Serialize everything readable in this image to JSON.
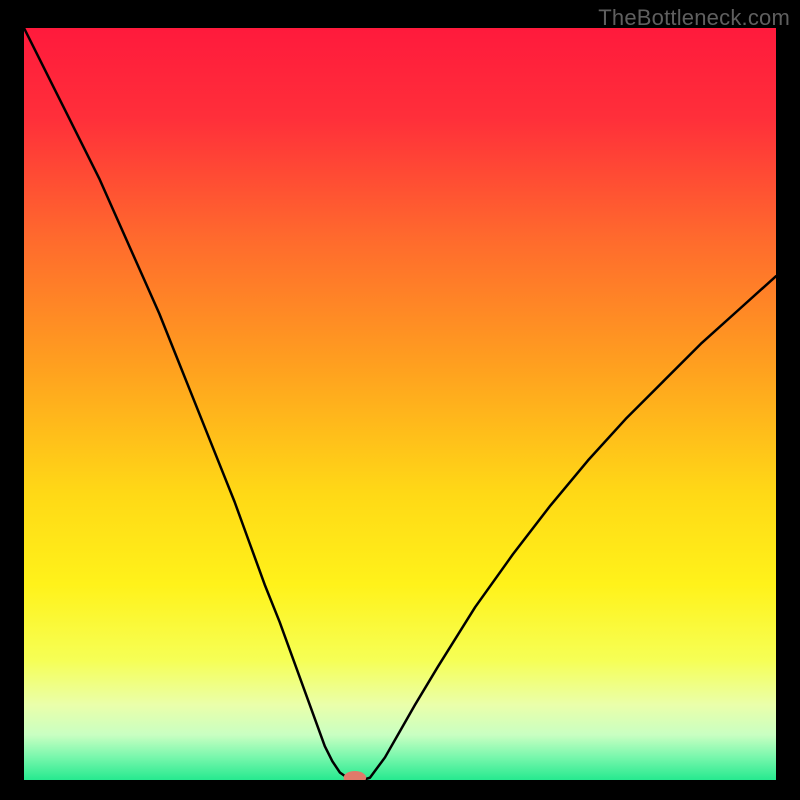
{
  "watermark": "TheBottleneck.com",
  "chart_data": {
    "type": "line",
    "title": "",
    "xlabel": "",
    "ylabel": "",
    "xlim": [
      0,
      100
    ],
    "ylim": [
      0,
      100
    ],
    "x": [
      0,
      2,
      4,
      6,
      8,
      10,
      12,
      14,
      16,
      18,
      20,
      22,
      24,
      26,
      28,
      30,
      32,
      34,
      36,
      38,
      40,
      41,
      42,
      43,
      44,
      45,
      46,
      48,
      50,
      52,
      55,
      60,
      65,
      70,
      75,
      80,
      85,
      90,
      95,
      100
    ],
    "values": [
      100,
      96,
      92,
      88,
      84,
      80,
      75.5,
      71,
      66.5,
      62,
      57,
      52,
      47,
      42,
      37,
      31.5,
      26,
      21,
      15.5,
      10,
      4.5,
      2.5,
      1.0,
      0.3,
      0.0,
      0.0,
      0.3,
      3,
      6.5,
      10,
      15,
      23,
      30,
      36.5,
      42.5,
      48,
      53,
      58,
      62.5,
      67
    ],
    "notch_marker": {
      "x": 44,
      "y": 0.0
    }
  },
  "gradient": {
    "stops": [
      {
        "offset": 0.0,
        "color": "#ff1a3c"
      },
      {
        "offset": 0.12,
        "color": "#ff2f3a"
      },
      {
        "offset": 0.28,
        "color": "#ff6a2d"
      },
      {
        "offset": 0.45,
        "color": "#ffa01f"
      },
      {
        "offset": 0.62,
        "color": "#ffd916"
      },
      {
        "offset": 0.74,
        "color": "#fff21a"
      },
      {
        "offset": 0.84,
        "color": "#f6ff55"
      },
      {
        "offset": 0.9,
        "color": "#eaffaa"
      },
      {
        "offset": 0.94,
        "color": "#c9ffc2"
      },
      {
        "offset": 0.97,
        "color": "#77f7ac"
      },
      {
        "offset": 1.0,
        "color": "#26e98f"
      }
    ]
  }
}
